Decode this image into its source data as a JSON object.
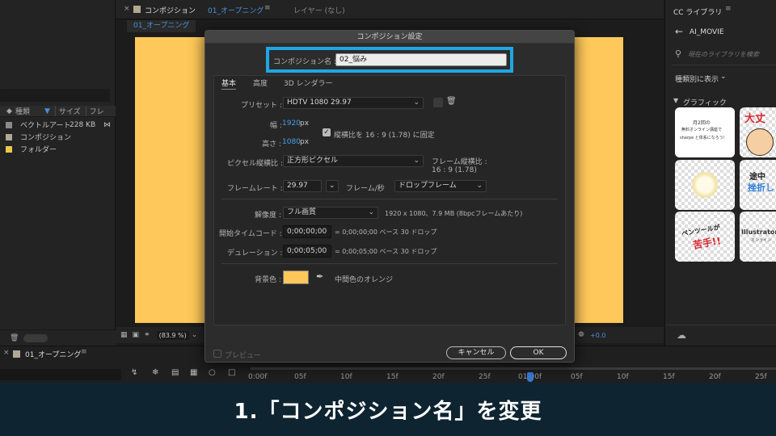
{
  "project": {
    "columns": {
      "name": "種類",
      "size": "サイズ",
      "frame": "フレ"
    },
    "items": [
      {
        "name": "ベクトルアート",
        "size": "228 KB",
        "color": "#8a8a8a"
      },
      {
        "name": "コンポジション",
        "size": "",
        "color": "#b0a894"
      },
      {
        "name": "フォルダー",
        "size": "",
        "color": "#e8c94a"
      }
    ]
  },
  "viewer": {
    "tab_prefix": "コンポジション",
    "tab_name": "01_オープニング",
    "layer_tab": "レイヤー (なし)",
    "sub_tab": "01_オープニング",
    "zoom": "(83.9 %)",
    "exposure": "+0.0",
    "canvas_color": "#fec85a"
  },
  "libraries": {
    "title": "CC ライブラリ",
    "library_name": "AI_MOVIE",
    "search_placeholder": "現在のライブラリを検索",
    "view_by": "種類別に表示",
    "section": "グラフィック",
    "thumbs": [
      {
        "text1": "月2回の",
        "text2": "無料オンライン講座で",
        "text3": "sharpe と体系になろう!"
      },
      {
        "text1": "大丈",
        "text2": "",
        "text3": ""
      },
      {
        "text1": "",
        "text2": "",
        "text3": ""
      },
      {
        "text1": "途中",
        "text2": "挫折し",
        "text3": ""
      },
      {
        "text1": "ペンツールが",
        "text2": "苦手!!",
        "text3": ""
      },
      {
        "text1": "Illustratorに",
        "text2": "オンライン",
        "text3": ""
      }
    ]
  },
  "timeline": {
    "tab_name": "01_オープニング",
    "ticks": [
      "0:00f",
      "05f",
      "10f",
      "15f",
      "20f",
      "25f",
      "01:00f",
      "05f",
      "10f",
      "15f",
      "20f",
      "25f"
    ]
  },
  "dialog": {
    "title": "コンポジション設定",
    "name_label": "コンポジション名 :",
    "name_value": "02_悩み",
    "tabs": [
      "基本",
      "高度",
      "3D レンダラー"
    ],
    "preset_label": "プリセット :",
    "preset_value": "HDTV 1080 29.97",
    "width_label": "幅 :",
    "width_value": "1920",
    "height_label": "高さ :",
    "height_value": "1080",
    "unit_px": "px",
    "lock_aspect": "縦横比を 16 : 9 (1.78) に固定",
    "pixel_aspect_label": "ピクセル縦横比 :",
    "pixel_aspect_value": "正方形ピクセル",
    "frame_aspect_label": "フレーム縦横比 :",
    "frame_aspect_value": "16 : 9 (1.78)",
    "framerate_label": "フレームレート :",
    "framerate_value": "29.97",
    "framerate_unit": "フレーム/秒",
    "drop_frame": "ドロップフレーム",
    "resolution_label": "解像度 :",
    "resolution_value": "フル画質",
    "resolution_info": "1920 x 1080、7.9 MB (8bpcフレームあたり)",
    "start_tc_label": "開始タイムコード :",
    "start_tc_value": "0;00;00;00",
    "start_tc_info": "= 0;00;00;00  ベース 30  ドロップ",
    "duration_label": "デュレーション :",
    "duration_value": "0;00;05;00",
    "duration_info": "= 0;00;05;00  ベース 30  ドロップ",
    "bg_label": "背景色 :",
    "bg_color": "#fdc75a",
    "bg_name": "中間色のオレンジ",
    "preview_label": "プレビュー",
    "cancel_label": "キャンセル",
    "ok_label": "OK"
  },
  "caption": "1.「コンポジション名」を変更",
  "highlight_color": "#1ea7e4"
}
